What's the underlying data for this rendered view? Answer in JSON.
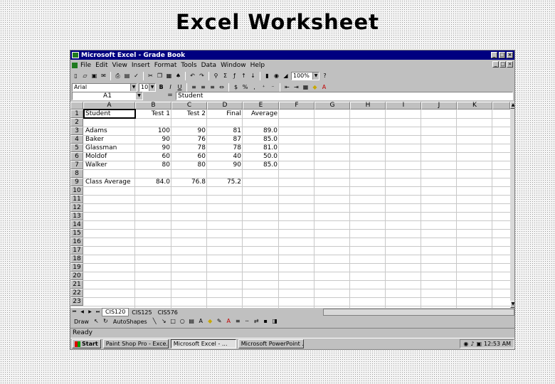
{
  "slide_title": "Excel Worksheet",
  "window": {
    "title": "Microsoft Excel - Grade Book"
  },
  "menu": [
    "File",
    "Edit",
    "View",
    "Insert",
    "Format",
    "Tools",
    "Data",
    "Window",
    "Help"
  ],
  "toolbar1": {
    "zoom": "100%"
  },
  "toolbar2": {
    "font": "Arial",
    "size": "10"
  },
  "formula_bar": {
    "name_box": "A1",
    "eq": "=",
    "content": "Student"
  },
  "columns": [
    "A",
    "B",
    "C",
    "D",
    "E",
    "F",
    "G",
    "H",
    "I",
    "J",
    "K"
  ],
  "rows": [
    "1",
    "2",
    "3",
    "4",
    "5",
    "6",
    "7",
    "8",
    "9",
    "10",
    "11",
    "12",
    "13",
    "14",
    "15",
    "16",
    "17",
    "18",
    "19",
    "20",
    "21",
    "22",
    "23"
  ],
  "sheet": {
    "header": [
      "Student",
      "Test 1",
      "Test 2",
      "Final",
      "Average"
    ],
    "students": [
      [
        "Adams",
        "100",
        "90",
        "81",
        "89.0"
      ],
      [
        "Baker",
        "90",
        "76",
        "87",
        "85.0"
      ],
      [
        "Glassman",
        "90",
        "78",
        "78",
        "81.0"
      ],
      [
        "Moldof",
        "60",
        "60",
        "40",
        "50.0"
      ],
      [
        "Walker",
        "80",
        "80",
        "90",
        "85.0"
      ]
    ],
    "class_average": [
      "Class Average",
      "84.0",
      "76.8",
      "75.2"
    ]
  },
  "sheet_tabs": [
    "CIS120",
    "CIS125",
    "CIS576"
  ],
  "drawing": {
    "draw": "Draw",
    "autoshapes": "AutoShapes"
  },
  "status": "Ready",
  "taskbar": {
    "start": "Start",
    "items": [
      "Paint Shop Pro - Exce...",
      "Microsoft Excel - ...",
      "Microsoft PowerPoint ..."
    ],
    "clock": "12:53 AM"
  }
}
